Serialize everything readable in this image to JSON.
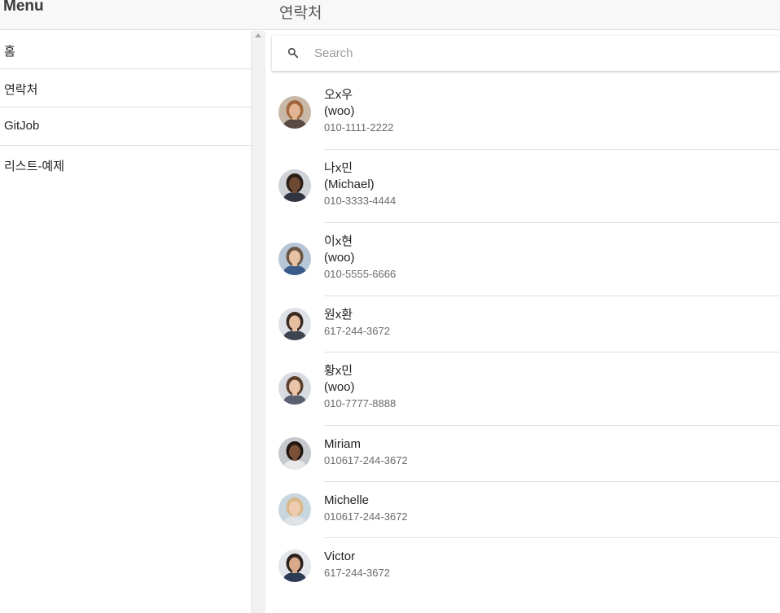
{
  "menu": {
    "title": "Menu",
    "items": [
      {
        "label": "홈"
      },
      {
        "label": "연락처"
      },
      {
        "label": "GitJob"
      },
      {
        "label": "리스트-예제"
      }
    ]
  },
  "page": {
    "title": "연락처"
  },
  "search": {
    "placeholder": "Search",
    "value": ""
  },
  "contacts": [
    {
      "name": "오x우",
      "nickname": "(woo)",
      "phone": "010-1111-2222",
      "avatar": {
        "skin": "#e2b493",
        "hair": "#a0663a",
        "shirt": "#5a4a44",
        "bg": "#c9b8a8"
      }
    },
    {
      "name": "나x민",
      "nickname": "(Michael)",
      "phone": "010-3333-4444",
      "avatar": {
        "skin": "#6e4a33",
        "hair": "#2b1f17",
        "shirt": "#2f3440",
        "bg": "#cfd3d8"
      }
    },
    {
      "name": "이x현",
      "nickname": "(woo)",
      "phone": "010-5555-6666",
      "avatar": {
        "skin": "#e8c2a4",
        "hair": "#6b5543",
        "shirt": "#3a5a8a",
        "bg": "#b7c6d6"
      }
    },
    {
      "name": "원x환",
      "phone": "617-244-3672",
      "avatar": {
        "skin": "#e6bfa3",
        "hair": "#3b2a22",
        "shirt": "#3d4450",
        "bg": "#dfe3e8"
      }
    },
    {
      "name": "황x민",
      "nickname": "(woo)",
      "phone": "010-7777-8888",
      "avatar": {
        "skin": "#e9c4a8",
        "hair": "#5c3f2c",
        "shirt": "#596070",
        "bg": "#d8dbe0"
      }
    },
    {
      "name": "Miriam",
      "phone": "010617-244-3672",
      "avatar": {
        "skin": "#7a5038",
        "hair": "#1f1611",
        "shirt": "#e8e8ea",
        "bg": "#c5c8cc"
      }
    },
    {
      "name": "Michelle",
      "phone": "010617-244-3672",
      "avatar": {
        "skin": "#efcbb0",
        "hair": "#d9b98b",
        "shirt": "#dfe3e6",
        "bg": "#c8d6df"
      }
    },
    {
      "name": "Victor",
      "phone": "617-244-3672",
      "avatar": {
        "skin": "#d9a98a",
        "hair": "#2a211c",
        "shirt": "#2e3b55",
        "bg": "#e3e6ea"
      }
    }
  ],
  "icons": {
    "search": "search-icon",
    "scroll_up": "scroll-up-arrow-icon"
  }
}
